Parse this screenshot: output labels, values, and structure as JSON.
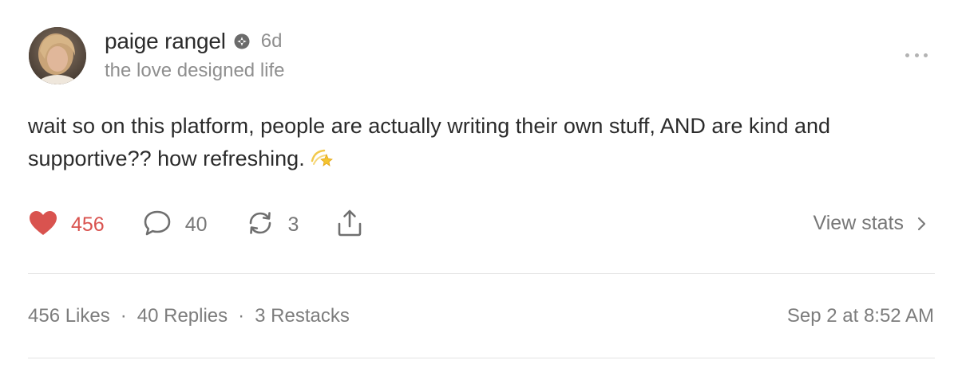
{
  "post": {
    "author": {
      "name": "paige rangel",
      "verified_icon": "verified-badge-icon",
      "age": "6d",
      "subtitle": "the love designed life"
    },
    "menu_icon": "more-horizontal-icon",
    "body_text": "wait so on this platform, people are actually writing their own stuff, AND are kind and supportive?? how refreshing.",
    "body_emoji": "dizzy-star-emoji",
    "actions": {
      "like": {
        "icon": "heart-icon",
        "count": "456",
        "active": true
      },
      "reply": {
        "icon": "comment-bubble-icon",
        "count": "40"
      },
      "restack": {
        "icon": "restack-arrows-icon",
        "count": "3"
      },
      "share": {
        "icon": "share-upload-icon"
      }
    },
    "view_stats_label": "View stats",
    "summary": {
      "likes": "456 Likes",
      "replies": "40 Replies",
      "restacks": "3 Restacks",
      "separator": "·"
    },
    "timestamp": "Sep 2 at 8:52 AM"
  },
  "colors": {
    "like_active": "#d9534f",
    "muted_text": "#8f8f8f",
    "divider": "#e4e4e4"
  }
}
